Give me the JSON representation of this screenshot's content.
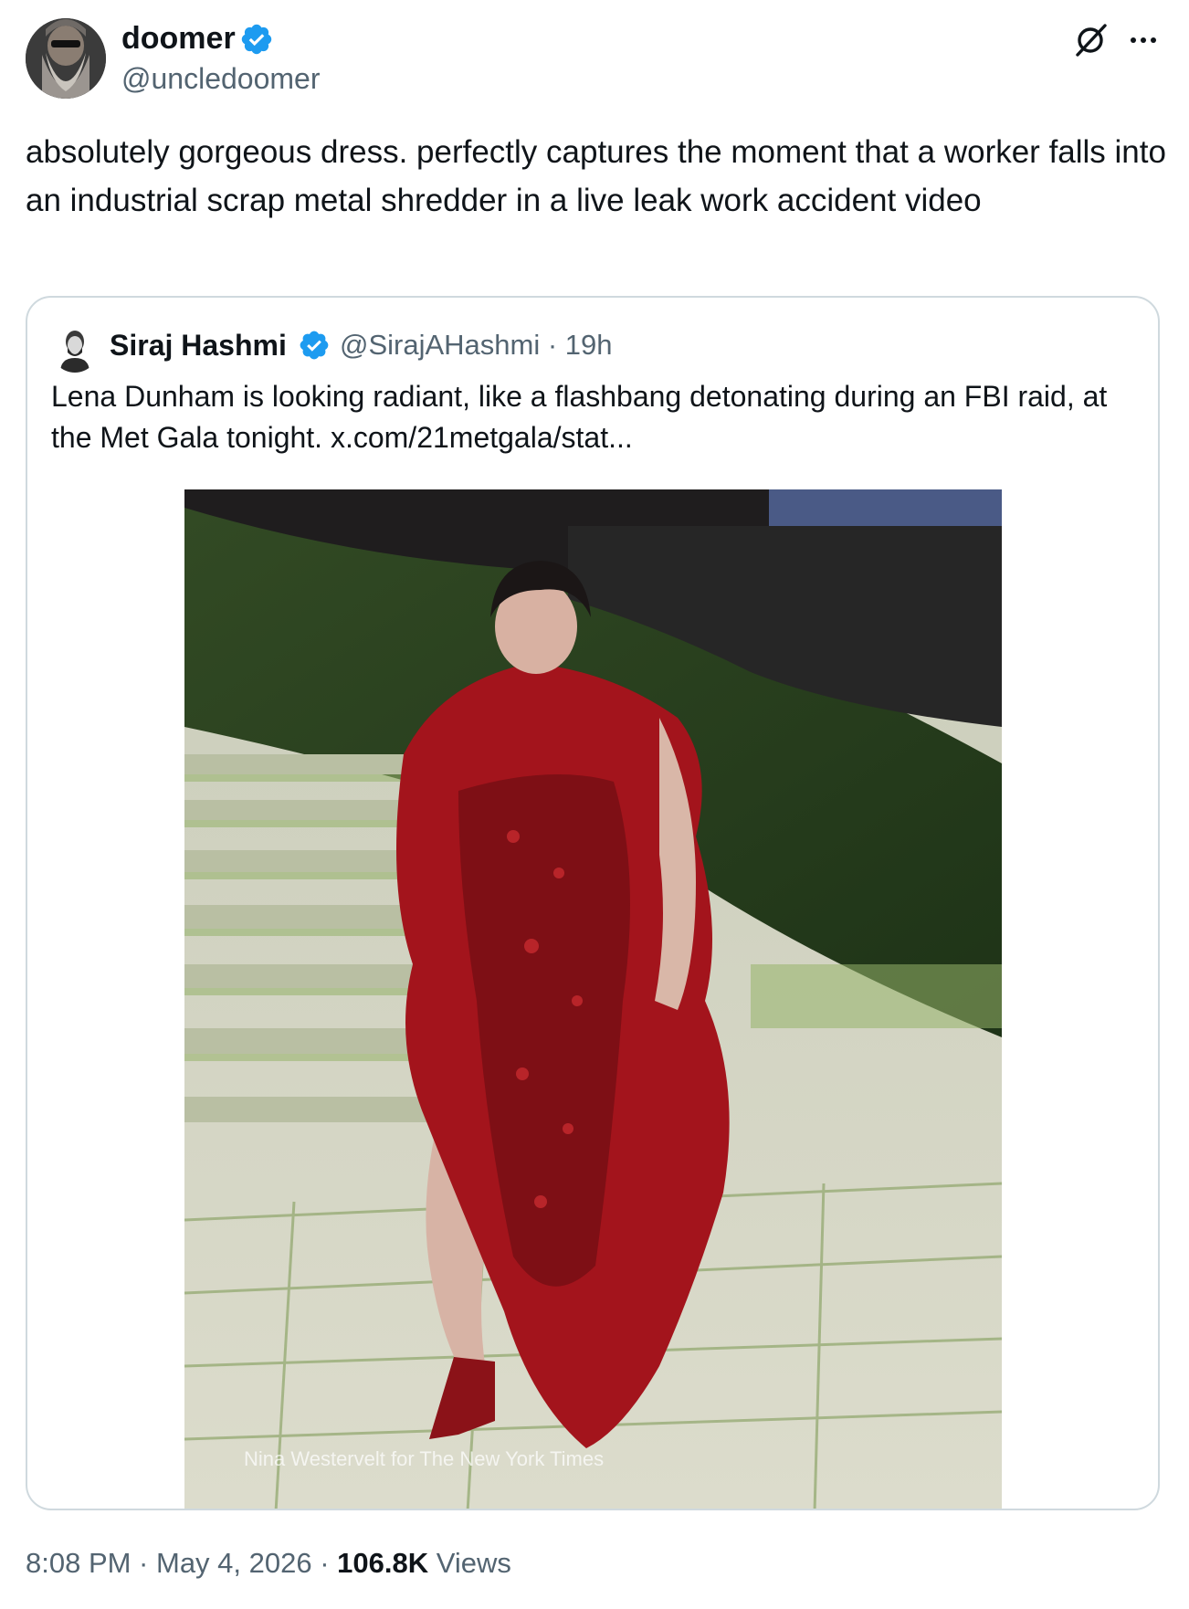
{
  "author": {
    "display_name": "doomer",
    "handle": "@uncledoomer"
  },
  "tweet": {
    "text": "absolutely gorgeous dress. perfectly captures the moment that a worker falls into an industrial scrap metal shredder in a live leak work accident video"
  },
  "quoted_tweet": {
    "display_name": "Siraj Hashmi",
    "handle_time": "@SirajAHashmi · 19h",
    "text": "Lena Dunham is looking radiant, like a flashbang detonating during an FBI raid, at the Met Gala tonight.  x.com/21metgala/stat...",
    "photo_credit": "Nina Westervelt for The New York Times"
  },
  "meta": {
    "timestamp": "8:08 PM · May 4, 2026 · ",
    "views_count": "106.8K",
    "views_label": " Views"
  },
  "icons": {
    "verified": "verified-badge-icon",
    "grok": "grok-icon",
    "more": "more-options-icon"
  },
  "colors": {
    "verified_blue": "#1d9bf0",
    "text_primary": "#0f1419",
    "text_secondary": "#536471",
    "border": "#cfd9de"
  }
}
